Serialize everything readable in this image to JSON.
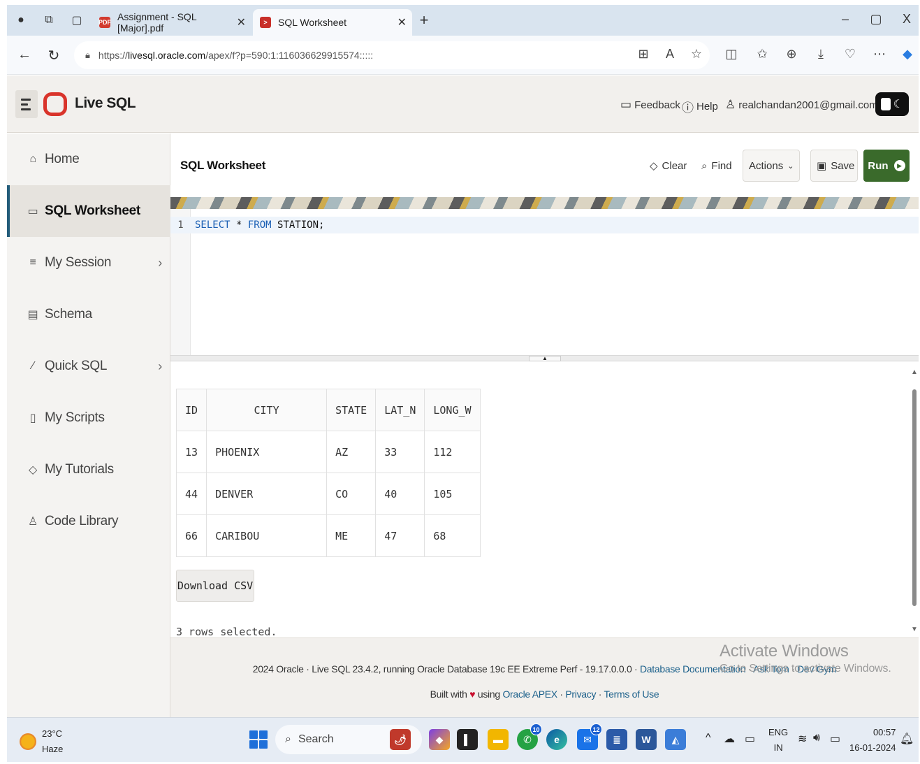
{
  "browser": {
    "tabs": [
      {
        "title": "Assignment - SQL [Major].pdf",
        "active": false
      },
      {
        "title": "SQL Worksheet",
        "active": true
      }
    ],
    "new_tab": "+",
    "url_prefix": "https://",
    "url_host": "livesql.oracle.com",
    "url_path": "/apex/f?p=590:1:116036629915574:::::",
    "window": {
      "minimize": "–",
      "restore": "▢",
      "close": "X"
    }
  },
  "header": {
    "app_title": "Live SQL",
    "feedback": "Feedback",
    "help": "Help",
    "user": "realchandan2001@gmail.com",
    "user_chevron": "⌄"
  },
  "sidebar": {
    "items": [
      {
        "label": "Home",
        "icon": "home-icon",
        "glyph": "⌂",
        "chevron": "",
        "active": false
      },
      {
        "label": "SQL Worksheet",
        "icon": "terminal-icon",
        "glyph": "▭",
        "chevron": "",
        "active": true
      },
      {
        "label": "My Session",
        "icon": "list-icon",
        "glyph": "≡",
        "chevron": "›",
        "active": false
      },
      {
        "label": "Schema",
        "icon": "database-icon",
        "glyph": "▤",
        "chevron": "",
        "active": false
      },
      {
        "label": "Quick SQL",
        "icon": "wand-icon",
        "glyph": "⁄",
        "chevron": "›",
        "active": false
      },
      {
        "label": "My Scripts",
        "icon": "document-icon",
        "glyph": "▯",
        "chevron": "",
        "active": false
      },
      {
        "label": "My Tutorials",
        "icon": "graduation-icon",
        "glyph": "◇",
        "chevron": "",
        "active": false
      },
      {
        "label": "Code Library",
        "icon": "library-icon",
        "glyph": "♙",
        "chevron": "",
        "active": false
      }
    ]
  },
  "worksheet": {
    "title": "SQL Worksheet",
    "clear": "Clear",
    "find": "Find",
    "actions": "Actions",
    "save": "Save",
    "run": "Run",
    "line_number": "1",
    "code_kw1": "SELECT",
    "code_mid": " * ",
    "code_kw2": "FROM",
    "code_rest": " STATION;"
  },
  "results": {
    "columns": [
      "ID",
      "CITY",
      "STATE",
      "LAT_N",
      "LONG_W"
    ],
    "rows": [
      [
        "13",
        "PHOENIX",
        "AZ",
        "33",
        "112"
      ],
      [
        "44",
        "DENVER",
        "CO",
        "40",
        "105"
      ],
      [
        "66",
        "CARIBOU",
        "ME",
        "47",
        "68"
      ]
    ],
    "download_csv": "Download CSV",
    "rows_selected": "3 rows selected."
  },
  "footer": {
    "line1_text": "2024 Oracle · Live SQL 23.4.2, running Oracle Database 19c EE Extreme Perf - 19.17.0.0.0 · ",
    "doc_link": "Database Documentation",
    "sep1": " · ",
    "ask_tom": "Ask Tom",
    "sep2": " · ",
    "dev_gym": "Dev Gym",
    "built_with": "Built with ",
    "using": " using ",
    "oracle_apex": "Oracle APEX",
    "sep3": " · ",
    "privacy": "Privacy",
    "sep4": " · ",
    "terms": "Terms of Use"
  },
  "watermark": {
    "line1": "Activate Windows",
    "line2": "Go to Settings to activate Windows."
  },
  "taskbar": {
    "temperature": "23°C",
    "weather": "Haze",
    "search": "Search",
    "whatsapp_badge": "10",
    "mail_badge": "12",
    "lang1": "ENG",
    "lang2": "IN",
    "time": "00:57",
    "date": "16-01-2024"
  },
  "colors": {
    "run_button": "#3a6a2b",
    "oracle_red": "#d9342b",
    "link": "#1a5f8a",
    "active_indicator": "#235c7a"
  }
}
